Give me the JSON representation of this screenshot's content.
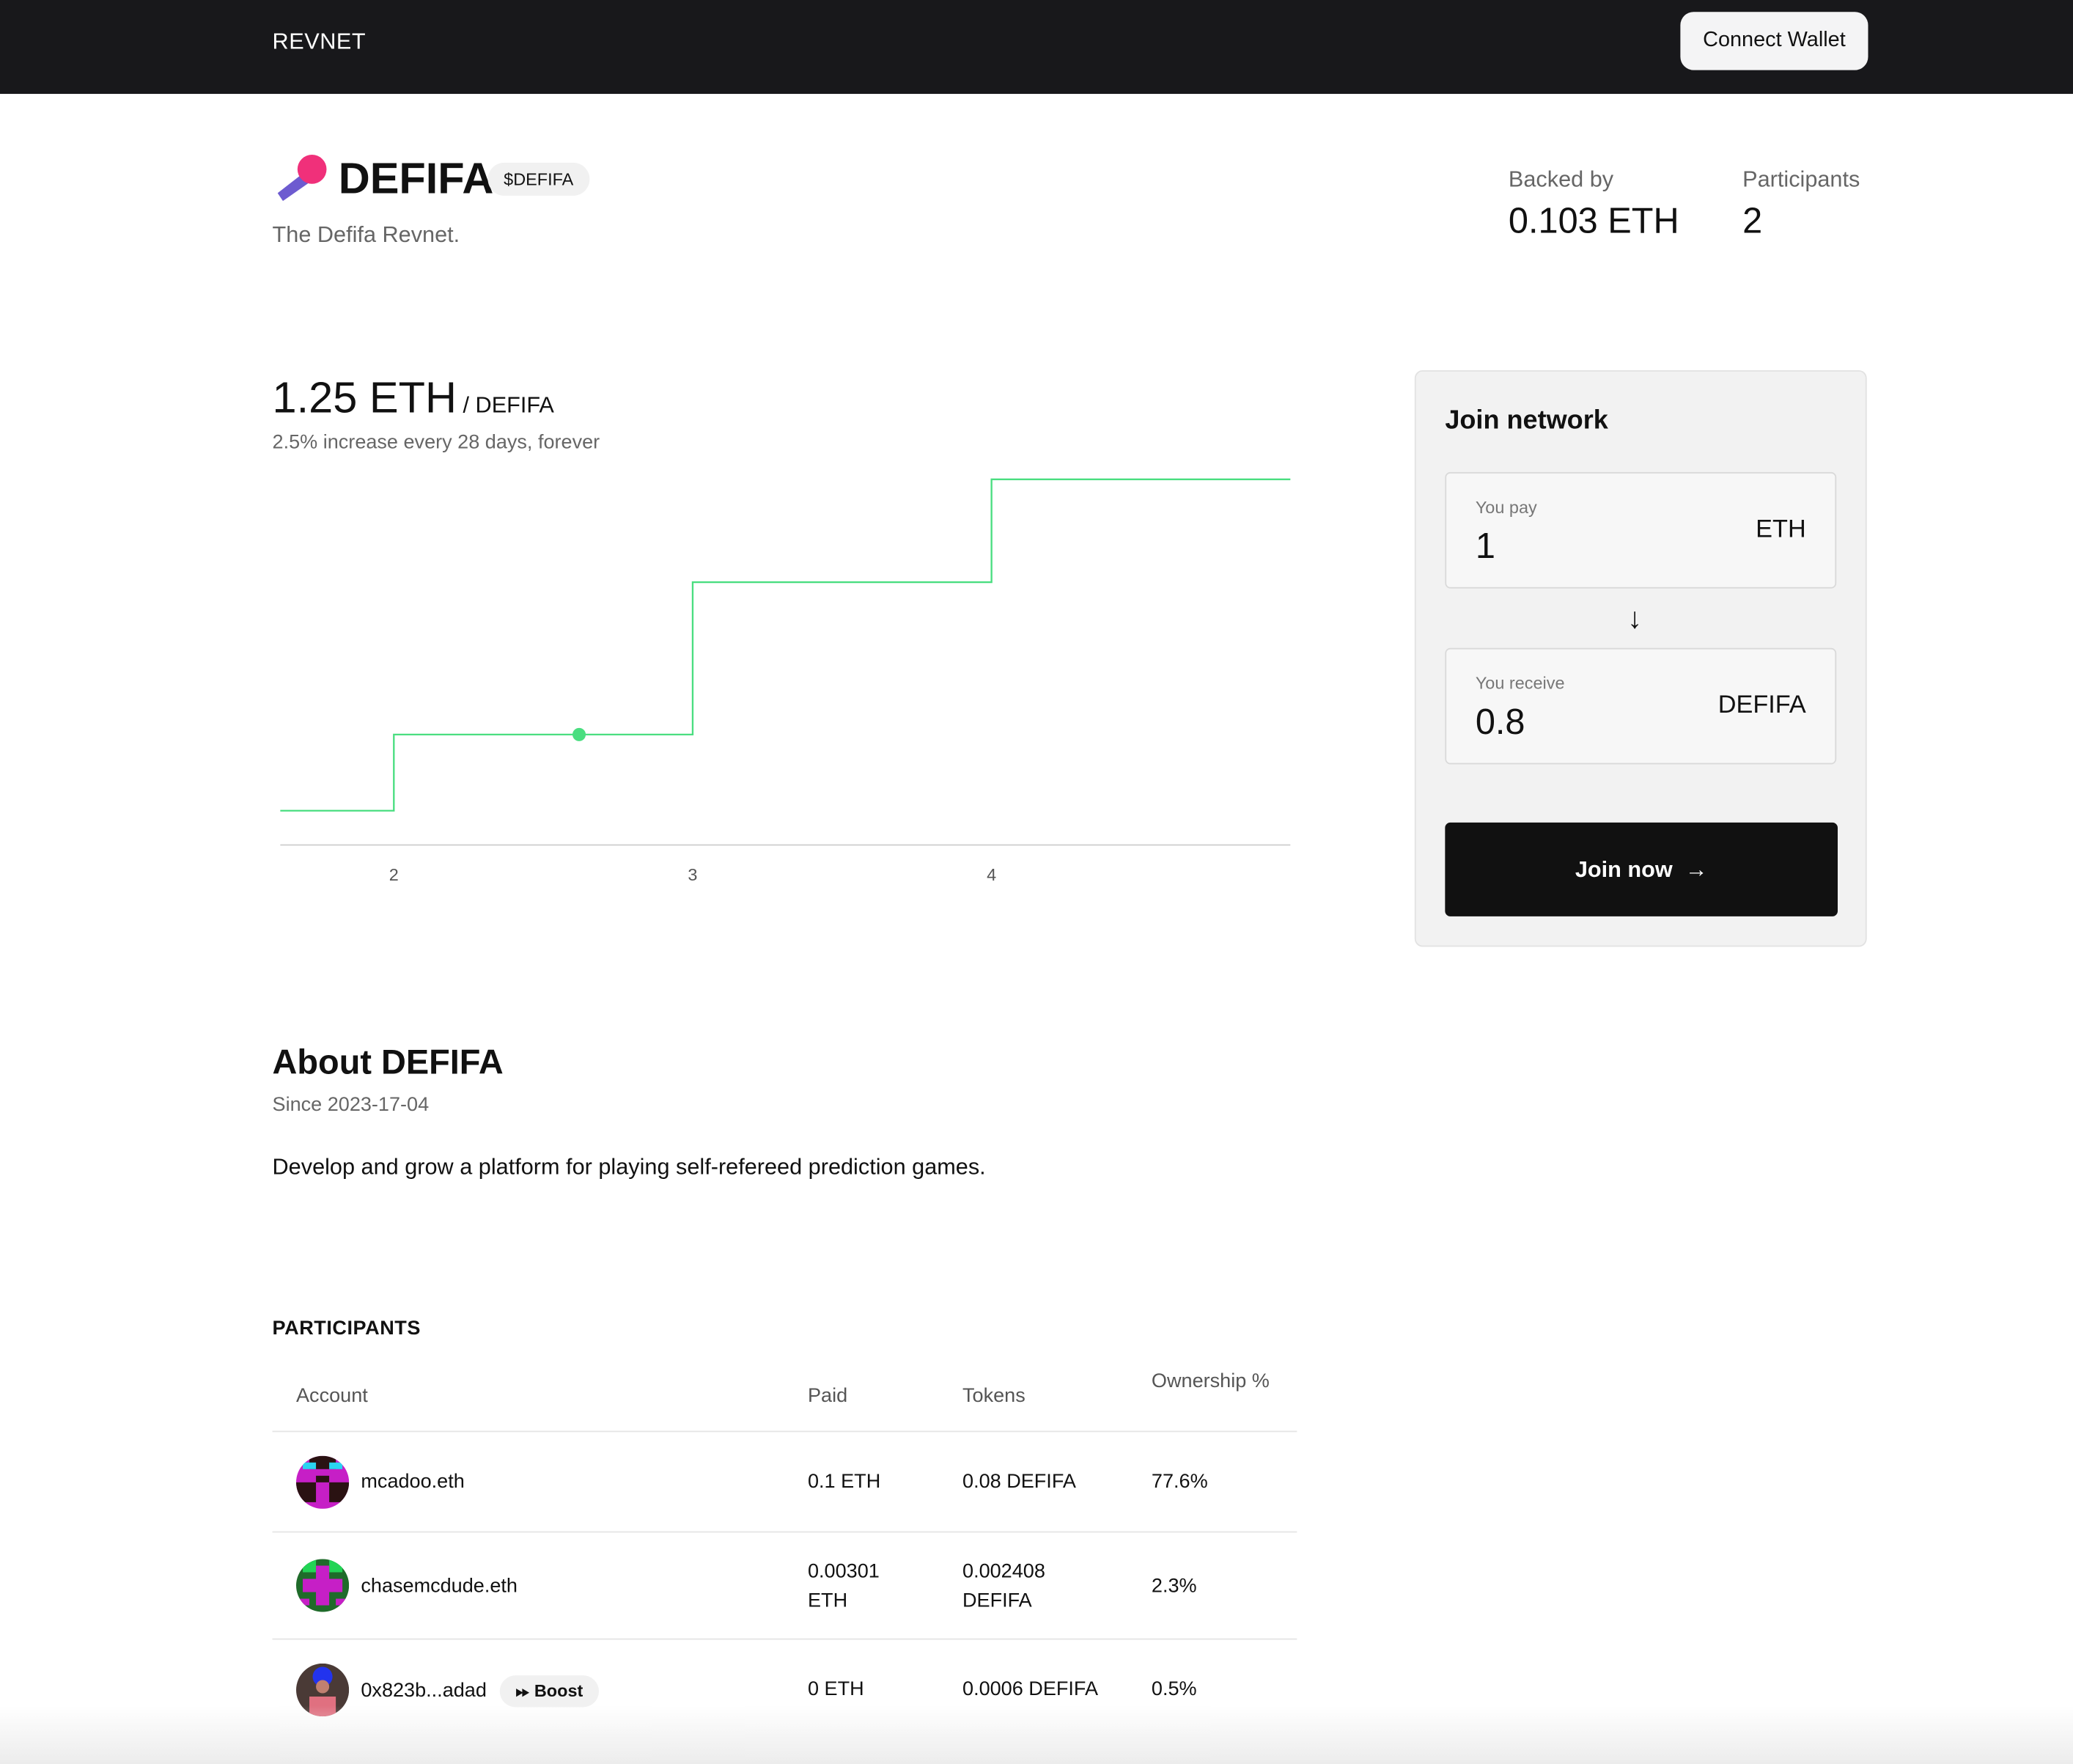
{
  "nav": {
    "brand": "REVNET",
    "connect_wallet": "Connect Wallet"
  },
  "project": {
    "name": "DEFIFA",
    "ticker": "$DEFIFA",
    "tagline": "The Defifa Revnet."
  },
  "stats": {
    "backed_label": "Backed by",
    "backed_value": "0.103 ETH",
    "participants_label": "Participants",
    "participants_value": "2"
  },
  "price": {
    "value": "1.25 ETH",
    "unit": "/ DEFIFA",
    "subtitle": "2.5% increase every 28 days, forever"
  },
  "chart_data": {
    "type": "line",
    "step": true,
    "x_ticks": [
      "2",
      "3",
      "4"
    ],
    "xlim": [
      1.62,
      5.0
    ],
    "steps": [
      {
        "x_start": 1.62,
        "y": 0.27
      },
      {
        "x_start": 2,
        "y": 0.87
      },
      {
        "x_start": 3,
        "y": 2.07
      },
      {
        "x_start": 4,
        "y": 2.88
      }
    ],
    "ylim": [
      0,
      3
    ],
    "current_point": {
      "x": 2.62,
      "y": 0.87
    },
    "color": "#4ade80",
    "grid": false
  },
  "join": {
    "title": "Join network",
    "pay_label": "You pay",
    "pay_value": "1",
    "pay_currency": "ETH",
    "receive_label": "You receive",
    "receive_value": "0.8",
    "receive_currency": "DEFIFA",
    "button": "Join now",
    "arrow": "↓",
    "button_arrow": "→"
  },
  "about": {
    "title": "About DEFIFA",
    "since": "Since 2023-17-04",
    "description": "Develop and grow a platform for playing self-refereed prediction games."
  },
  "participants": {
    "heading": "PARTICIPANTS",
    "columns": [
      "Account",
      "Paid",
      "Tokens",
      "Ownership %"
    ],
    "rows": [
      {
        "account": "mcadoo.eth",
        "paid": "0.1 ETH",
        "tokens": "0.08 DEFIFA",
        "ownership": "77.6%"
      },
      {
        "account": "chasemcdude.eth",
        "paid": "0.00301 ETH",
        "tokens": "0.002408 DEFIFA",
        "ownership": "2.3%"
      },
      {
        "account": "0x823b...adad",
        "badge": "Boost",
        "paid": "0 ETH",
        "tokens": "0.0006 DEFIFA",
        "ownership": "0.5%"
      }
    ]
  }
}
